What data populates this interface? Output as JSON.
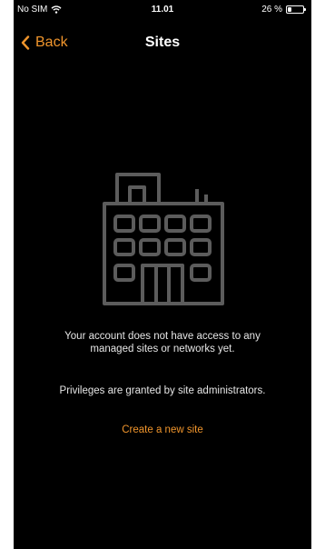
{
  "status_bar": {
    "carrier": "No SIM",
    "time": "11.01",
    "battery": "26 %",
    "battery_level": 0.26
  },
  "nav": {
    "back_label": "Back",
    "title": "Sites"
  },
  "empty_state": {
    "icon": "building-icon",
    "message": "Your account does not have access to any managed sites or networks yet.",
    "privileges_note": "Privileges are granted by site administrators.",
    "create_link": "Create a new site"
  },
  "colors": {
    "background": "#000000",
    "accent": "#f0952c",
    "icon_gray": "#5c5c5c",
    "text": "#e6e6e6"
  }
}
